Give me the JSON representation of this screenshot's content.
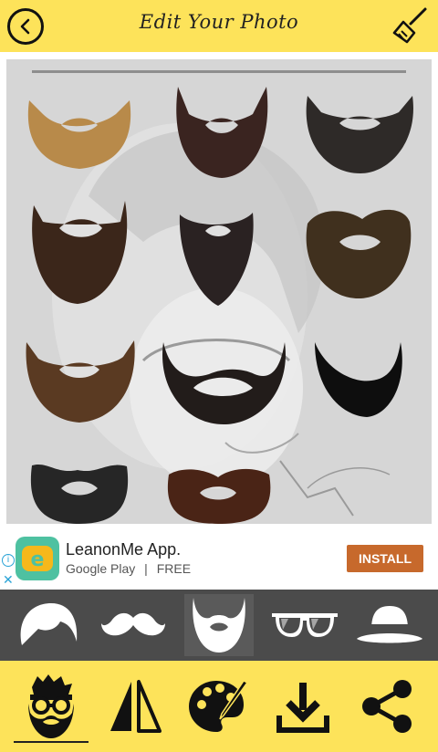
{
  "header": {
    "title": "Edit Your Photo",
    "back_icon": "back-arrow-icon",
    "clean_icon": "broom-icon",
    "background": "#fde35a"
  },
  "canvas": {
    "background": "#d6d6d6",
    "items": [
      {
        "name": "beard-1",
        "color": "#b88a4a"
      },
      {
        "name": "beard-2",
        "color": "#3a2420"
      },
      {
        "name": "beard-3",
        "color": "#2e2a28"
      },
      {
        "name": "beard-4",
        "color": "#3b261a"
      },
      {
        "name": "beard-5",
        "color": "#2a2222"
      },
      {
        "name": "beard-6",
        "color": "#40301e"
      },
      {
        "name": "beard-7",
        "color": "#5a3a22"
      },
      {
        "name": "beard-8",
        "color": "#221c1a"
      },
      {
        "name": "beard-9",
        "color": "#0e0e0e"
      },
      {
        "name": "beard-10",
        "color": "#262626"
      },
      {
        "name": "beard-11",
        "color": "#4a2416"
      }
    ]
  },
  "ad": {
    "title": "LeanonMe App.",
    "store": "Google Play",
    "separator": "|",
    "price": "FREE",
    "install_label": "INSTALL",
    "info_glyph": "i",
    "close_glyph": "✕",
    "install_color": "#c7692c"
  },
  "categories": [
    {
      "name": "hair",
      "icon": "hair-icon",
      "selected": false
    },
    {
      "name": "mustache",
      "icon": "mustache-icon",
      "selected": false
    },
    {
      "name": "beard",
      "icon": "beard-icon",
      "selected": true
    },
    {
      "name": "glasses",
      "icon": "glasses-icon",
      "selected": false
    },
    {
      "name": "hat",
      "icon": "hat-icon",
      "selected": false
    }
  ],
  "toolbar": [
    {
      "name": "face-stickers",
      "icon": "bearded-man-icon",
      "active": true
    },
    {
      "name": "flip",
      "icon": "flip-icon"
    },
    {
      "name": "color",
      "icon": "palette-icon"
    },
    {
      "name": "save",
      "icon": "download-icon"
    },
    {
      "name": "share",
      "icon": "share-icon"
    }
  ]
}
